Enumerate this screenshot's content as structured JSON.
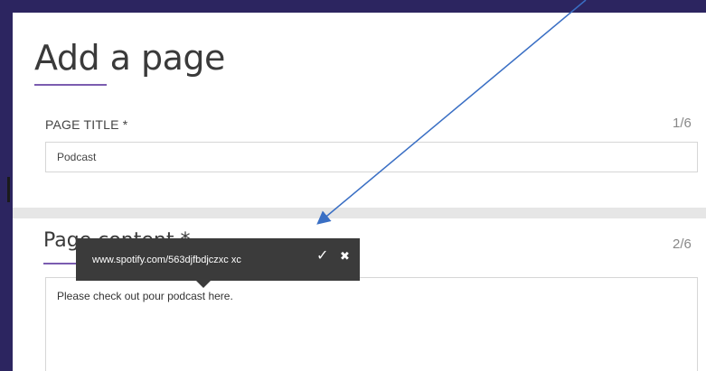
{
  "form": {
    "heading": "Add a page",
    "accent_color": "#7b5cb0",
    "frame_color": "#2c2560",
    "page_title": {
      "label": "PAGE TITLE *",
      "counter": "1/6",
      "value": "Podcast"
    },
    "page_content": {
      "label": "Page content *",
      "counter": "2/6",
      "value": "Please check out pour podcast here."
    }
  },
  "link_tooltip": {
    "url": "www.spotify.com/563djfbdjczxc xc",
    "confirm_icon": "checkmark-icon",
    "confirm_glyph": "✓",
    "cancel_icon": "close-icon",
    "cancel_glyph": "✖"
  },
  "annotation": {
    "color": "#3a6fc4",
    "icon": "arrow-icon"
  }
}
